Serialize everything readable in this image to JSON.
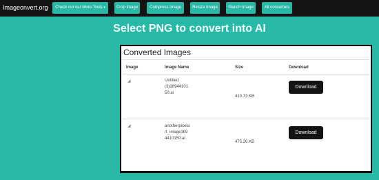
{
  "nav": {
    "brand": "Imageonvert.org",
    "tools_label": "Check out our More Tools",
    "crop_label": "Crop Image",
    "compress_label": "Compress Image",
    "resize_label": "Resize Image",
    "sketch_label": "Sketch Image",
    "all_label": "All converters"
  },
  "heading": "Select PNG to convert into AI",
  "card": {
    "title": "Converted Images",
    "columns": [
      "Image",
      "Image Name",
      "Size",
      "Download"
    ],
    "rows": [
      {
        "name_lines": [
          "Untitled",
          "(3)16944101",
          "50.ai"
        ],
        "size": "410.73 KB",
        "download_label": "Download"
      },
      {
        "name_lines": [
          "anotherpixela",
          "rt_image169",
          "4410150.ai"
        ],
        "size": "475.26 KB",
        "download_label": "Download"
      }
    ]
  },
  "colors": {
    "teal": "#28b9a6",
    "topbar": "#141414",
    "button_dark": "#141414"
  },
  "icons": {
    "thumbnail": "broken-image-icon",
    "caret": "caret-down-icon"
  }
}
